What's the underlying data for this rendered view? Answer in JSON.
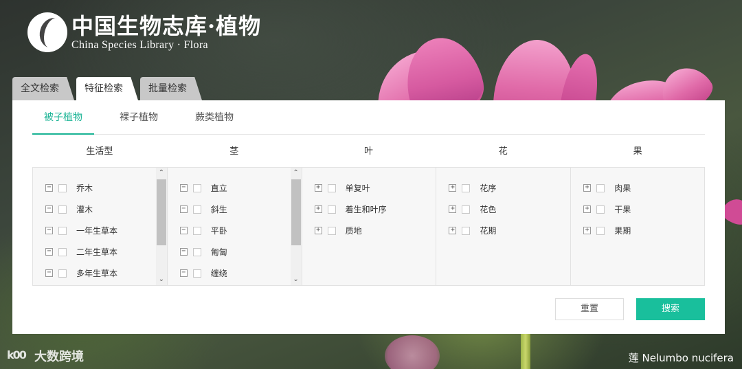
{
  "logo": {
    "cn": "中国生物志库·植物",
    "en": "China Species Library · Flora"
  },
  "top_tabs": [
    {
      "label": "全文检索"
    },
    {
      "label": "特征检索"
    },
    {
      "label": "批量检索"
    }
  ],
  "sub_tabs": [
    {
      "label": "被子植物"
    },
    {
      "label": "裸子植物"
    },
    {
      "label": "蕨类植物"
    }
  ],
  "columns": [
    {
      "title": "生活型",
      "items": [
        {
          "sign": "−",
          "label": "乔木"
        },
        {
          "sign": "−",
          "label": "灌木"
        },
        {
          "sign": "−",
          "label": "一年生草本"
        },
        {
          "sign": "−",
          "label": "二年生草本"
        },
        {
          "sign": "−",
          "label": "多年生草本"
        }
      ]
    },
    {
      "title": "茎",
      "items": [
        {
          "sign": "−",
          "label": "直立"
        },
        {
          "sign": "−",
          "label": "斜生"
        },
        {
          "sign": "−",
          "label": "平卧"
        },
        {
          "sign": "−",
          "label": "匍匐"
        },
        {
          "sign": "−",
          "label": "缠绕"
        }
      ]
    },
    {
      "title": "叶",
      "items": [
        {
          "sign": "+",
          "label": "单复叶"
        },
        {
          "sign": "+",
          "label": "着生和叶序"
        },
        {
          "sign": "+",
          "label": "质地"
        }
      ]
    },
    {
      "title": "花",
      "items": [
        {
          "sign": "+",
          "label": "花序"
        },
        {
          "sign": "+",
          "label": "花色"
        },
        {
          "sign": "+",
          "label": "花期"
        }
      ]
    },
    {
      "title": "果",
      "items": [
        {
          "sign": "+",
          "label": "肉果"
        },
        {
          "sign": "+",
          "label": "干果"
        },
        {
          "sign": "+",
          "label": "果期"
        }
      ]
    }
  ],
  "buttons": {
    "reset": "重置",
    "search": "搜索"
  },
  "watermark": {
    "icon": "k00",
    "text": "大数跨境"
  },
  "caption": "莲 Nelumbo nucifera",
  "colors": {
    "accent": "#19bf9c",
    "tab_active_text": "#19b394"
  }
}
